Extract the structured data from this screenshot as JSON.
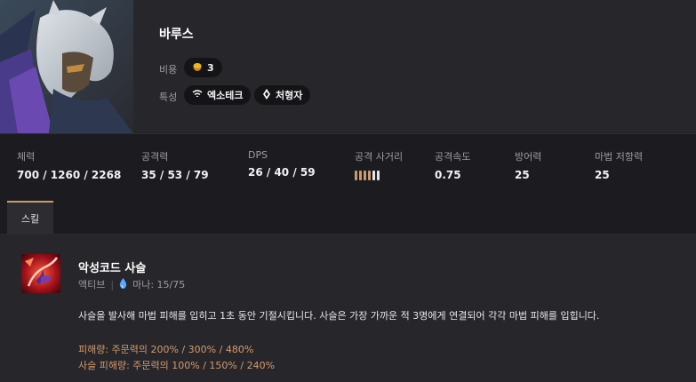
{
  "champion": {
    "name": "바루스",
    "cost_label": "비용",
    "cost_value": "3",
    "traits_label": "특성",
    "traits": [
      "엑소테크",
      "처형자"
    ]
  },
  "stats": [
    {
      "label": "체력",
      "value": "700 / 1260 / 2268"
    },
    {
      "label": "공격력",
      "value": "35 / 53 / 79"
    },
    {
      "label": "DPS",
      "value": "26 / 40 / 59"
    },
    {
      "label": "공격 사거리",
      "range": 6
    },
    {
      "label": "공격속도",
      "value": "0.75"
    },
    {
      "label": "방어력",
      "value": "25"
    },
    {
      "label": "마법 저항력",
      "value": "25"
    }
  ],
  "tabs": [
    {
      "label": "스킬"
    }
  ],
  "skill": {
    "name": "악성코드 사슬",
    "type": "액티브",
    "mana": "마나: 15/75",
    "description": "사슬을 발사해 마법 피해를 입히고 1초 동안 기절시킵니다. 사슬은 가장 가까운 적 3명에게 연결되어 각각 마법 피해를 입힙니다.",
    "damage_line": "피해량: 주문력의 200% / 300% / 480%",
    "chain_damage_line": "사슬 피해량: 주문력의 100% / 150% / 240%"
  },
  "colors": {
    "accent": "#c99b6b",
    "background": "#1c1c20",
    "panel": "#27272b",
    "damage_text": "#d39a6a",
    "mana_icon": "#5aa7ff",
    "gold": "#f0b429"
  },
  "icons": {
    "cost": "gold-coin-icon",
    "trait_1": "exotech-icon",
    "trait_2": "executioner-icon",
    "mana": "mana-drop-icon"
  }
}
